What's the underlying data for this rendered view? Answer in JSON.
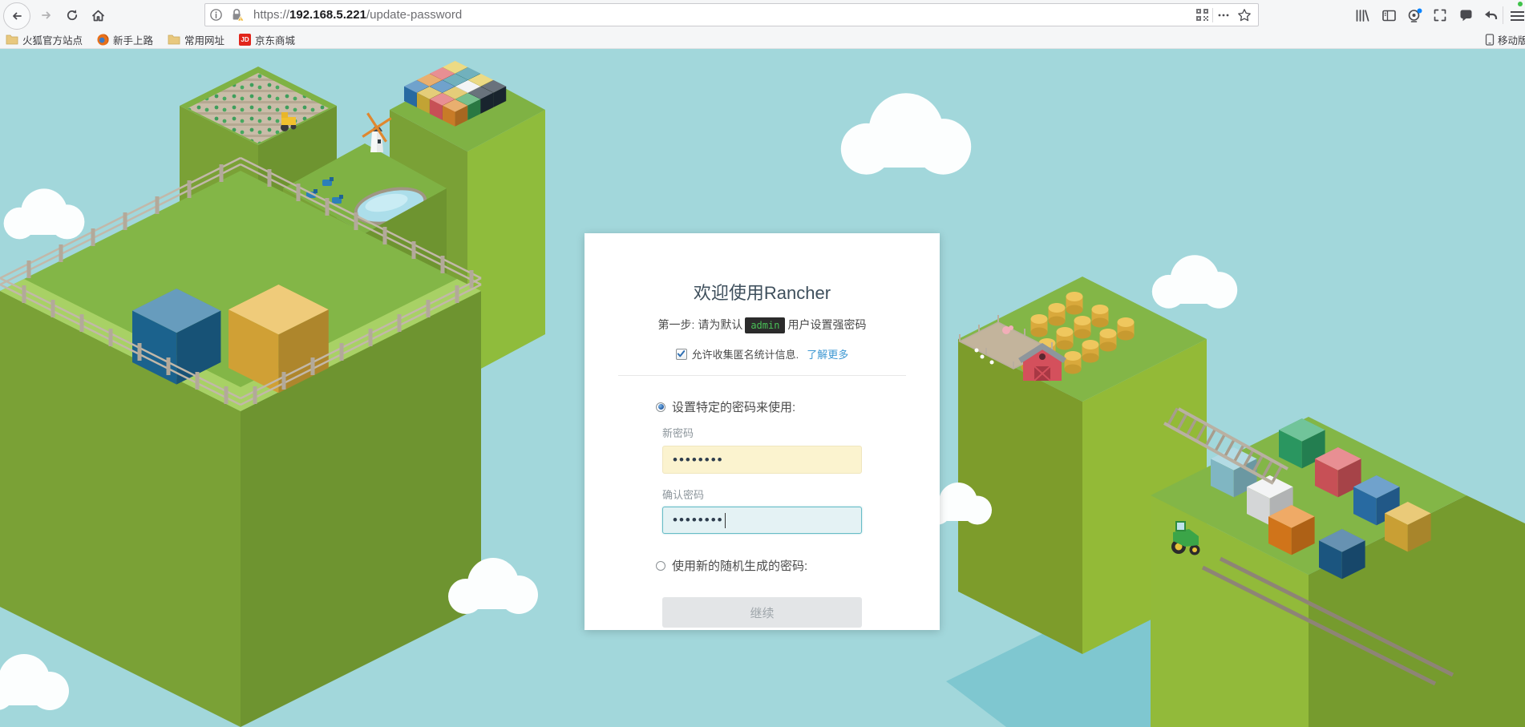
{
  "browser": {
    "url": {
      "scheme": "https://",
      "domain": "192.168.5.221",
      "path": "/update-password"
    },
    "bookmarks": [
      {
        "label": "火狐官方站点",
        "icon": "folder"
      },
      {
        "label": "新手上路",
        "icon": "firefox"
      },
      {
        "label": "常用网址",
        "icon": "folder"
      },
      {
        "label": "京东商城",
        "icon": "jd",
        "badge": "JD"
      }
    ],
    "mobile_bookmarks_label": "移动版书签"
  },
  "dialog": {
    "title": "欢迎使用Rancher",
    "step_prefix": "第一步: 请为默认",
    "step_user": "admin",
    "step_suffix": "用户设置强密码",
    "telemetry_label": "允许收集匿名统计信息.",
    "learn_more": "了解更多",
    "radio_specific": "设置特定的密码来使用:",
    "new_password_label": "新密码",
    "new_password_value": "••••••••",
    "confirm_password_label": "确认密码",
    "confirm_password_value": "••••••••",
    "radio_random": "使用新的随机生成的密码:",
    "continue_label": "继续"
  },
  "colors": {
    "sky": "#A2D7DB",
    "water": "#7FC7D0",
    "grass_top": "#83B647",
    "grass_light": "#A8D165",
    "link_blue": "#3D98D3",
    "admin_green": "#49C157",
    "badge_bg": "#2B2B2B",
    "input_autofill": "#FBF3CF",
    "input_focus_bg": "#E4F2F4",
    "input_focus_border": "#66BCC6",
    "button_bg": "#E3E5E7",
    "jd_red": "#E1251B"
  }
}
